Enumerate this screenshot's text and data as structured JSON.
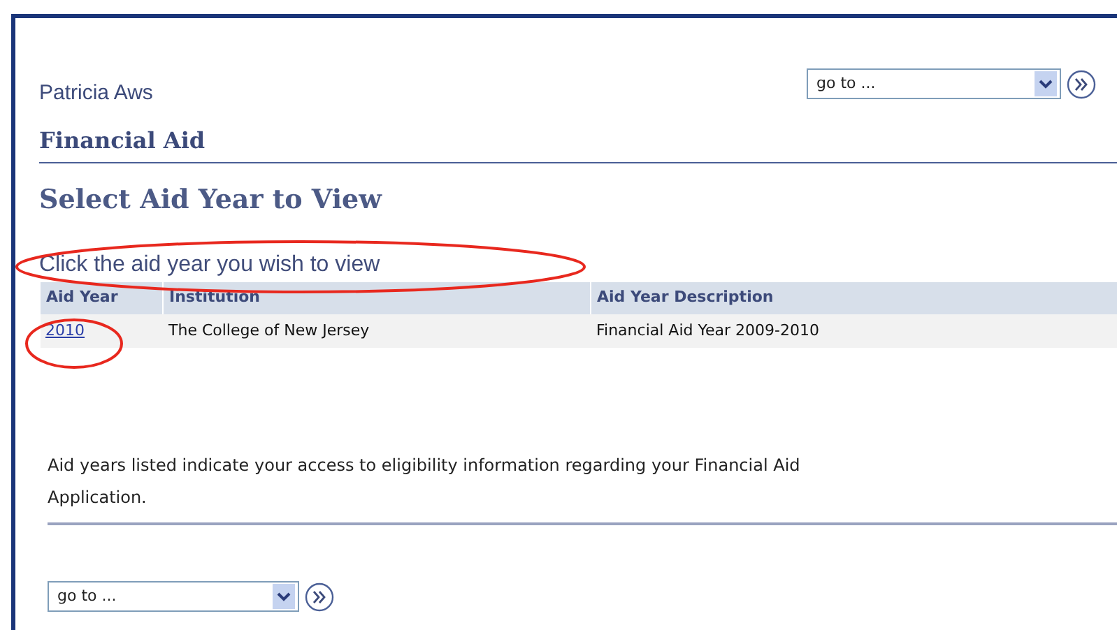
{
  "user_name": "Patricia Aws",
  "top_goto": {
    "value": "go to ..."
  },
  "section_title": "Financial Aid",
  "page_title": "Select Aid Year to View",
  "instruction": "Click the aid year you wish to view",
  "table": {
    "columns": [
      "Aid Year",
      "Institution",
      "Aid Year Description"
    ],
    "rows": [
      {
        "aid_year": "2010",
        "institution": "The College of New Jersey",
        "description": "Financial Aid Year 2009-2010"
      }
    ]
  },
  "note": "Aid years listed indicate your access to eligibility information regarding your Financial Aid Application.",
  "bottom_goto": {
    "value": "go to ..."
  }
}
